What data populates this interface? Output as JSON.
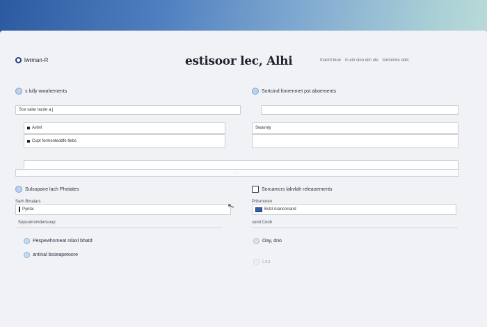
{
  "header": {
    "logo_text": "lwrman-R",
    "title": "estisoor lec, Alhi",
    "nav": [
      "Inarmt buie",
      "in ein sloo eiln ole",
      "tomoirme ubiit"
    ]
  },
  "section1": {
    "left_title": "s lully wwahements",
    "right_title": "Sortcind fonrenmet pst aboements",
    "left_top_value": "Sce salar tacde a.j",
    "right_top_value": "",
    "left_field1": "Avtivl",
    "right_field1": "Swavnty",
    "left_field2": "Cupt formenteddfe tlebs",
    "right_field2": "",
    "strip_marker": "◦"
  },
  "section2": {
    "left_title": "Sulsopane lach Photates",
    "right_title": "Sorcamcrs lakvlah releaoements",
    "left_label": "Sarh Bmaiars",
    "right_label": "Pritsmoren",
    "left_value": "Pynlal",
    "right_value": "Bstd  Aranconand",
    "left_sub": "Sopsonromdensoup",
    "right_sub": "sorol Cooh"
  },
  "options": {
    "left": [
      "Pespewhnmeat nilaxl bhatd",
      "antinal bsseapetoore"
    ],
    "right": [
      "Oay, dno",
      "Lsu"
    ]
  }
}
